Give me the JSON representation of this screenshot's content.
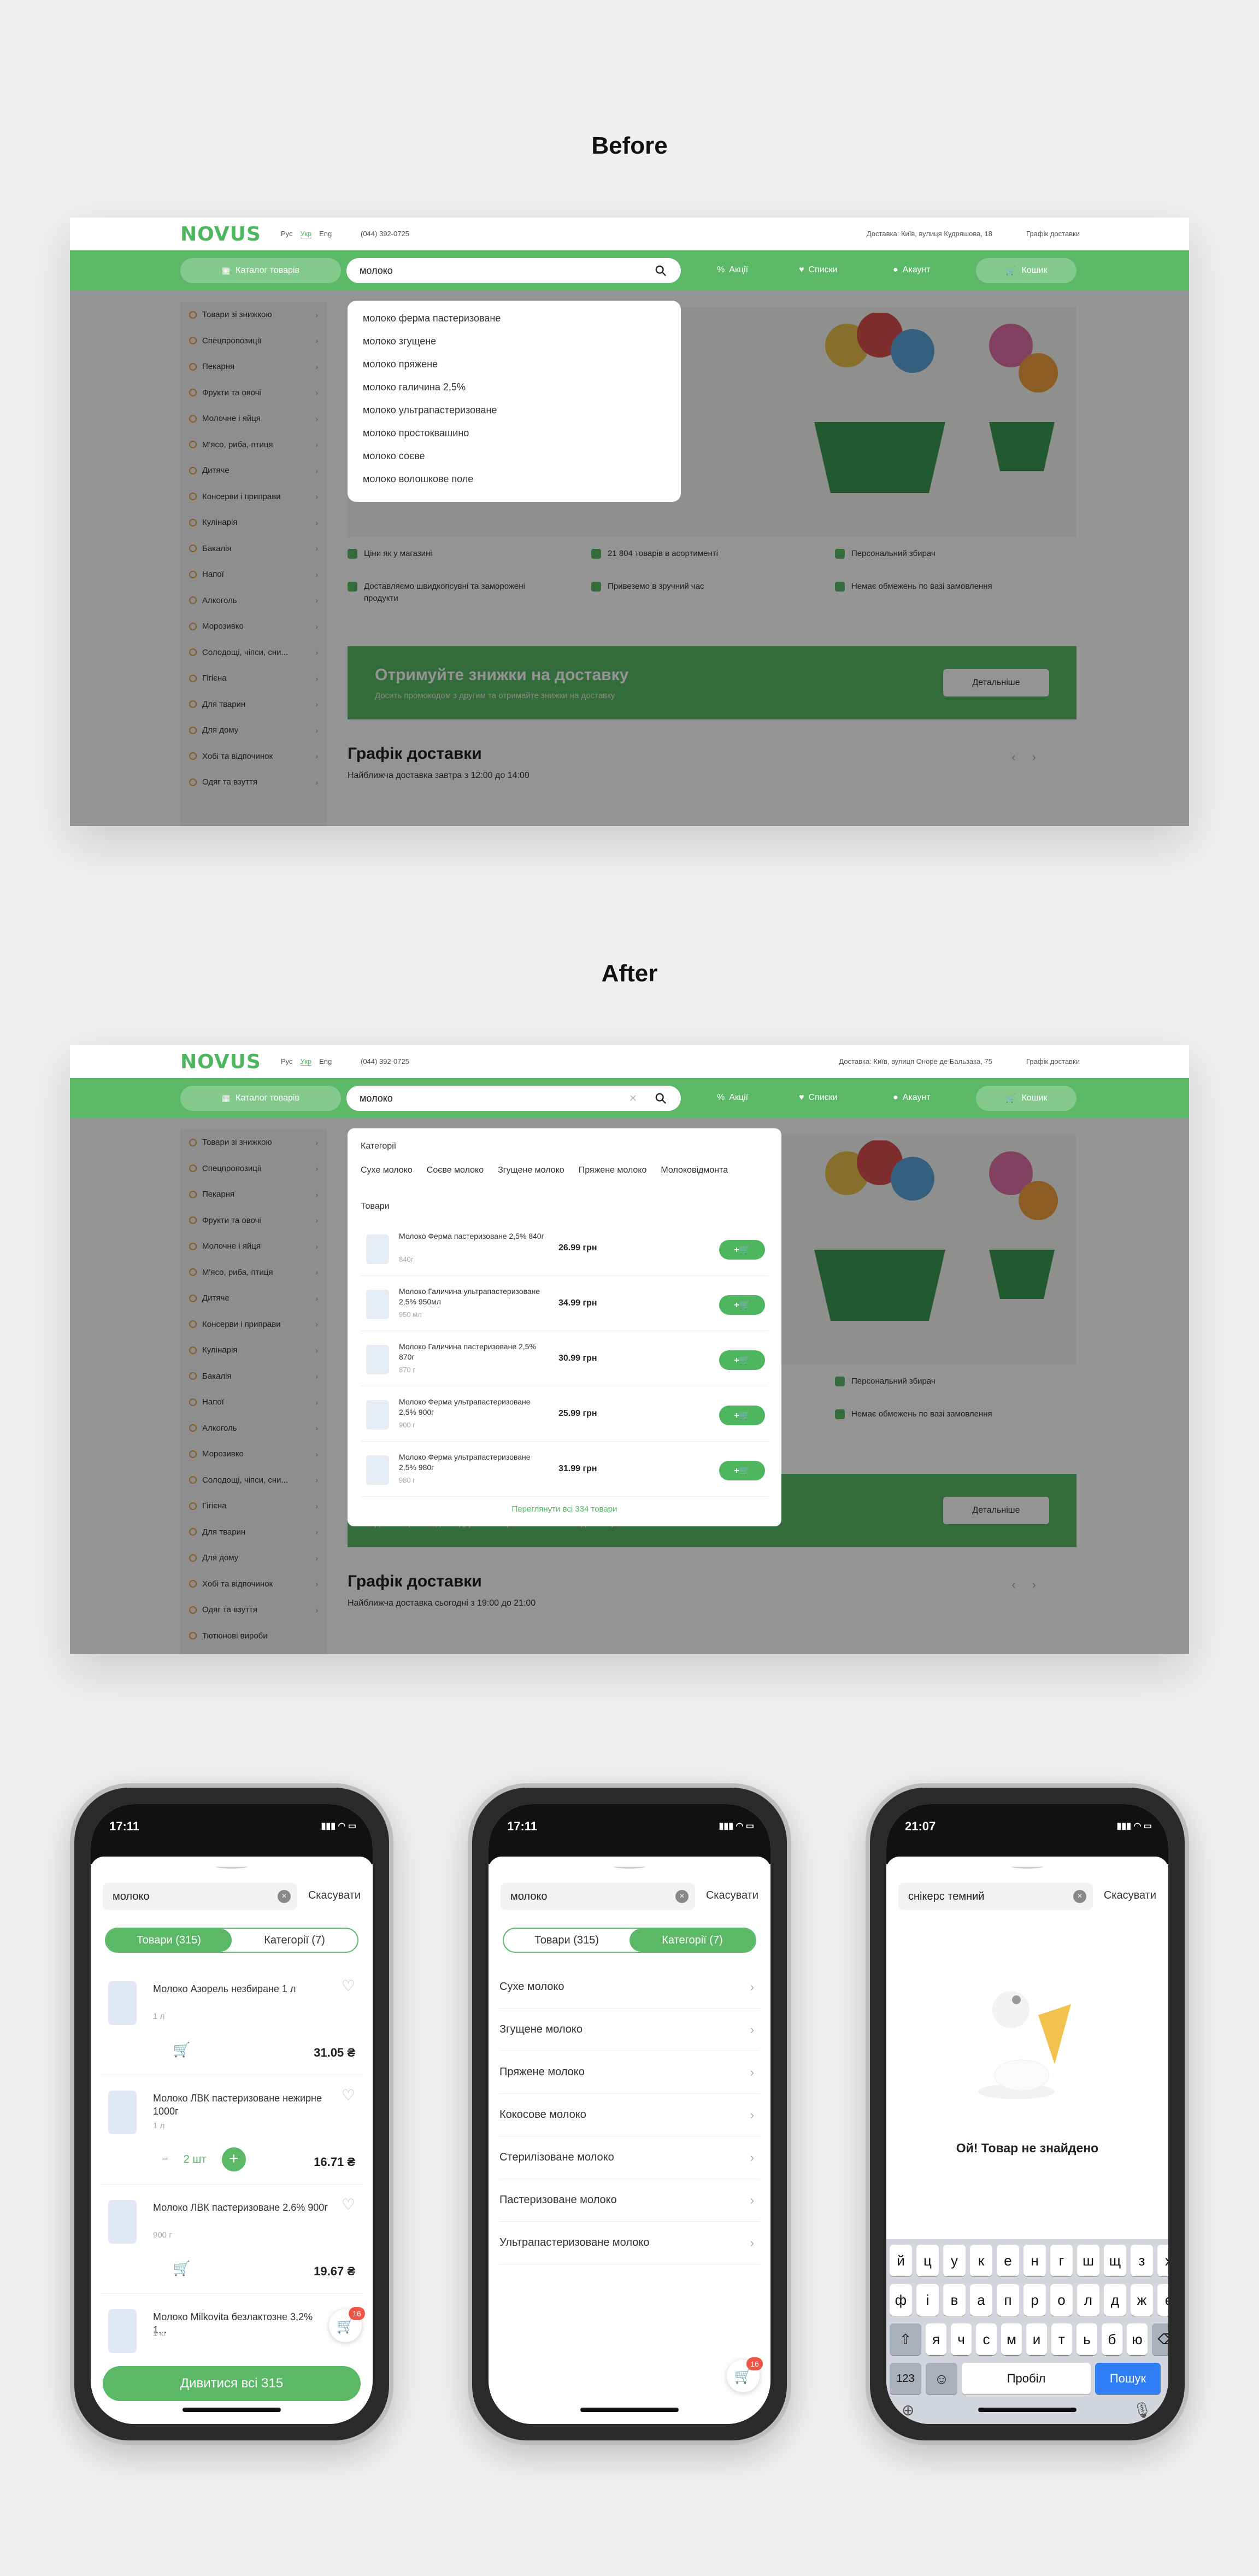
{
  "headings": {
    "before": "Before",
    "after": "After"
  },
  "header": {
    "logo": "NOVUS",
    "languages": [
      "Рус",
      "Укр",
      "Eng"
    ],
    "phone": "(044) 392-0725",
    "address_before": "Доставка: Київ, вулиця Кудряшова, 18",
    "address_after": "Доставка: Київ, вулиця Оноре де Бальзака, 75",
    "schedule": "Графік доставки"
  },
  "nav": {
    "catalog": "Каталог товарів",
    "search_value": "молоко",
    "promos": "Акції",
    "lists": "Списки",
    "account": "Акаунт",
    "cart": "Кошик"
  },
  "sidebar": {
    "items_before": [
      "Товари зі знижкою",
      "Спецпропозиції",
      "Пекарня",
      "Фрукти та овочі",
      "Молочне і яйця",
      "М'ясо, риба, птиця",
      "Дитяче",
      "Консерви і приправи",
      "Кулінарія",
      "Бакалія",
      "Напої",
      "Алкоголь",
      "Морозивко",
      "Солодощі, чіпси, сни...",
      "Гігієна",
      "Для тварин",
      "Для дому",
      "Хобі та відпочинок",
      "Одяг та взуття"
    ],
    "items_after_extra": "Тютюнові вироби"
  },
  "suggestions_before": [
    "молоко ферма пастеризоване",
    "молоко згущене",
    "молоко пряжене",
    "молоко галичина 2,5%",
    "молоко ультрапастеризоване",
    "молоко простоквашино",
    "молоко соєве",
    "молоко волошкове поле"
  ],
  "features": [
    "Ціни як у магазині",
    "21 804 товарів в асортименті",
    "Персональний збирач",
    "Доставляємо швидкопсувні та заморожені продукти",
    "Привеземо в зручний час",
    "Немає обмежень по вазі замовлення"
  ],
  "promo": {
    "title": "Отримуйте знижки на доставку",
    "subtitle": "Досить промокодом з другим та отримайте знижки на доставку",
    "button": "Детальніше"
  },
  "delivery": {
    "title": "Графік доставки",
    "before": "Найближча доставка завтра з 12:00 до 14:00",
    "after": "Найближча доставка сьогодні з 19:00 до 21:00"
  },
  "dropdown_after": {
    "categories_label": "Категорії",
    "chips": [
      "Сухе молоко",
      "Соєве молоко",
      "Згущене молоко",
      "Пряжене молоко",
      "Молоковідмонта"
    ],
    "products_label": "Товари",
    "products": [
      {
        "name": "Молоко Ферма пастеризоване 2,5% 840г",
        "weight": "840г",
        "price": "26.99 грн"
      },
      {
        "name": "Молоко Галичина ультрапастеризоване 2,5% 950мл",
        "weight": "950 мл",
        "price": "34.99 грн"
      },
      {
        "name": "Молоко Галичина пастеризоване 2,5% 870г",
        "weight": "870 г",
        "price": "30.99 грн"
      },
      {
        "name": "Молоко Ферма ультрапастеризоване 2,5% 900г",
        "weight": "900 г",
        "price": "25.99 грн"
      },
      {
        "name": "Молоко Ферма ультрапастеризоване 2,5% 980г",
        "weight": "980 г",
        "price": "31.99 грн"
      }
    ],
    "add_label": "+🛒",
    "see_all": "Переглянути всі 334 товари"
  },
  "phone1": {
    "time": "17:11",
    "search": "молоко",
    "cancel": "Скасувати",
    "tab_products": "Товари (315)",
    "tab_categories": "Категорії (7)",
    "products": [
      {
        "name": "Молоко Азорель незбиране 1 л",
        "weight": "1 л",
        "price": "31.05 ₴"
      },
      {
        "name": "Молоко ЛВК пастеризоване нежирне 1000г",
        "weight": "1 л",
        "price": "16.71 ₴",
        "qty": "2 шт"
      },
      {
        "name": "Молоко ЛВК пастеризоване 2.6% 900г",
        "weight": "900 г",
        "price": "19.67 ₴"
      },
      {
        "name": "Молоко Milkovita безлактозне 3,2% 1...",
        "weight": "1 кг",
        "price": ""
      }
    ],
    "see_all": "Дивитися всі 315",
    "cart_badge": "16"
  },
  "phone2": {
    "time": "17:11",
    "search": "молоко",
    "cancel": "Скасувати",
    "tab_products": "Товари (315)",
    "tab_categories": "Категорії (7)",
    "categories": [
      "Сухе молоко",
      "Згущене молоко",
      "Пряжене молоко",
      "Кокосове молоко",
      "Стерилізоване молоко",
      "Пастеризоване молоко",
      "Ультрапастеризоване молоко"
    ],
    "cart_badge": "16"
  },
  "phone3": {
    "time": "21:07",
    "search": "снікерс темний",
    "cancel": "Скасувати",
    "not_found": "Ой! Товар не знайдено",
    "keys_row1": [
      "й",
      "ц",
      "у",
      "к",
      "е",
      "н",
      "г",
      "ш",
      "щ",
      "з",
      "х"
    ],
    "keys_row2": [
      "ф",
      "і",
      "в",
      "а",
      "п",
      "р",
      "о",
      "л",
      "д",
      "ж",
      "є"
    ],
    "keys_row3": [
      "я",
      "ч",
      "с",
      "м",
      "и",
      "т",
      "ь",
      "б",
      "ю"
    ],
    "key_123": "123",
    "key_space": "Пробіл",
    "key_go": "Пошук"
  },
  "colors": {
    "brand_green": "#5ab866",
    "badge_red": "#e54444"
  }
}
